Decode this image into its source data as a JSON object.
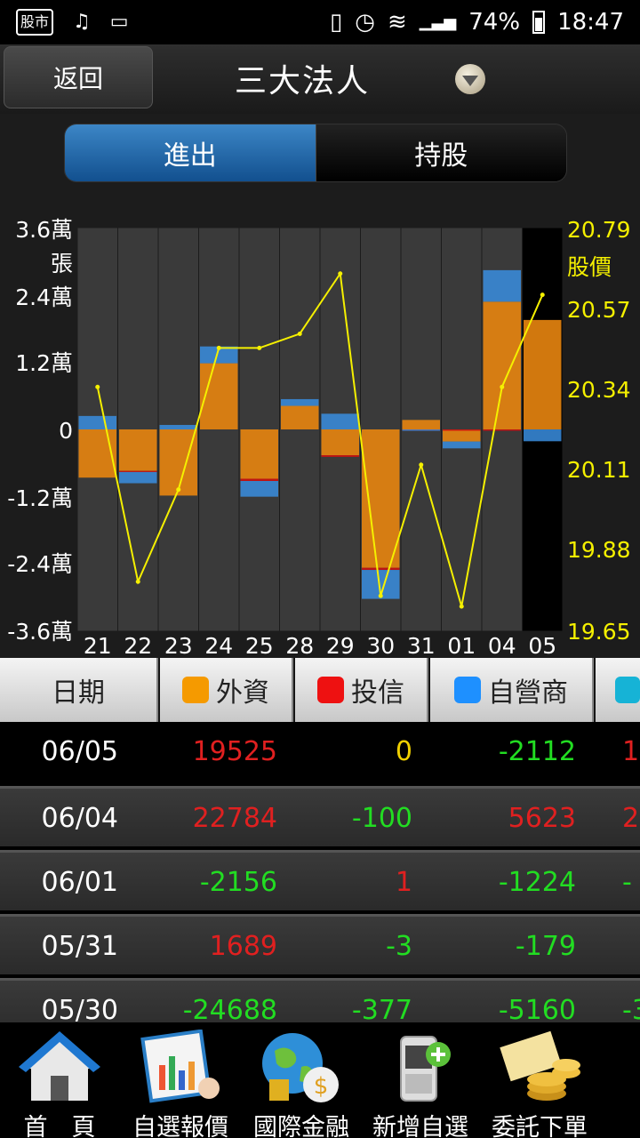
{
  "status_bar": {
    "app_badge": "股市",
    "battery": "74%",
    "time": "18:47"
  },
  "header": {
    "back_label": "返回",
    "title": "三大法人"
  },
  "tabs": [
    {
      "label": "進出",
      "active": true
    },
    {
      "label": "持股",
      "active": false
    }
  ],
  "chart_data": {
    "type": "bar",
    "categories": [
      "21",
      "22",
      "23",
      "24",
      "25",
      "28",
      "29",
      "30",
      "31",
      "01",
      "04",
      "05"
    ],
    "y_left_ticks": [
      "3.6萬",
      "張",
      "2.4萬",
      "1.2萬",
      "0",
      "-1.2萬",
      "-2.4萬",
      "-3.6萬"
    ],
    "y_left_range": [
      -36000,
      36000
    ],
    "y_right_ticks": [
      "20.79",
      "股價",
      "20.57",
      "20.34",
      "20.11",
      "19.88",
      "19.65"
    ],
    "y_right_range": [
      19.65,
      20.79
    ],
    "series": [
      {
        "name": "外資",
        "color": "#e8850f",
        "values": [
          -8600,
          -7400,
          -11800,
          11800,
          -8800,
          4200,
          -4600,
          -24688,
          1689,
          -2156,
          22784,
          19525
        ]
      },
      {
        "name": "投信",
        "color": "#cc1010",
        "values": [
          0,
          -200,
          0,
          0,
          -400,
          0,
          -300,
          -377,
          -3,
          1,
          -100,
          0
        ]
      },
      {
        "name": "自營商",
        "color": "#3a8ee0",
        "values": [
          2400,
          -2000,
          800,
          3000,
          -2800,
          1200,
          2800,
          -5160,
          -179,
          -1224,
          5623,
          -2112
        ]
      }
    ],
    "price_line": {
      "color": "#f5f000",
      "values": [
        20.34,
        19.79,
        20.05,
        20.45,
        20.45,
        20.49,
        20.66,
        19.75,
        20.12,
        19.72,
        20.34,
        20.6
      ]
    },
    "highlight_last": true
  },
  "table": {
    "headers": [
      {
        "label": "日期",
        "swatch": ""
      },
      {
        "label": "外資",
        "swatch": "#f59a00"
      },
      {
        "label": "投信",
        "swatch": "#ee1111"
      },
      {
        "label": "自營商",
        "swatch": "#1e90ff"
      },
      {
        "label": "",
        "swatch": "#16b3d6"
      }
    ],
    "rows": [
      {
        "date": "06/05",
        "foreign": "19525",
        "trust": "0",
        "dealer": "-2112",
        "extra": "1"
      },
      {
        "date": "06/04",
        "foreign": "22784",
        "trust": "-100",
        "dealer": "5623",
        "extra": "2"
      },
      {
        "date": "06/01",
        "foreign": "-2156",
        "trust": "1",
        "dealer": "-1224",
        "extra": "-"
      },
      {
        "date": "05/31",
        "foreign": "1689",
        "trust": "-3",
        "dealer": "-179",
        "extra": ""
      },
      {
        "date": "05/30",
        "foreign": "-24688",
        "trust": "-377",
        "dealer": "-5160",
        "extra": "-3"
      }
    ]
  },
  "bottom_nav": [
    {
      "label": "首　頁",
      "icon": "home-icon"
    },
    {
      "label": "自選報價",
      "icon": "chart-report-icon"
    },
    {
      "label": "國際金融",
      "icon": "globe-money-icon"
    },
    {
      "label": "新增自選",
      "icon": "phone-add-icon"
    },
    {
      "label": "委託下單",
      "icon": "coins-order-icon"
    }
  ]
}
